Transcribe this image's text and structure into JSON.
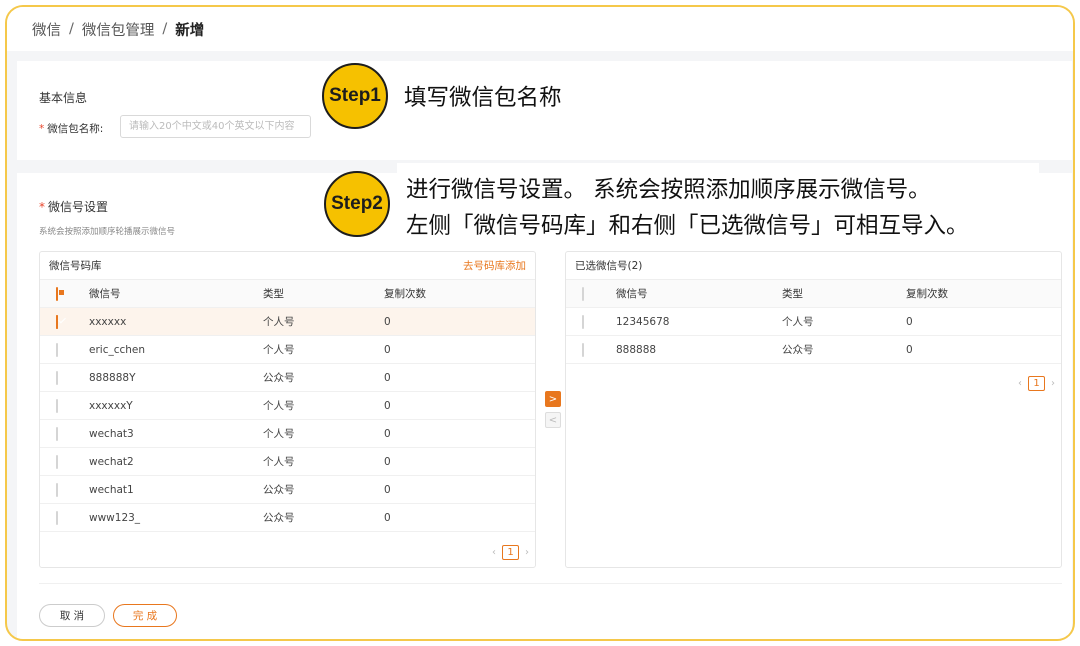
{
  "breadcrumb": {
    "root": "微信",
    "parent": "微信包管理",
    "current": "新增",
    "separator": "/"
  },
  "basic": {
    "title": "基本信息",
    "name_label": "微信包名称:",
    "name_placeholder": "请输入20个中文或40个英文以下内容"
  },
  "wechat_settings": {
    "title": "微信号设置",
    "desc": "系统会按照添加顺序轮播展示微信号"
  },
  "library": {
    "title": "微信号码库",
    "add_link": "去号码库添加",
    "columns": [
      "微信号",
      "类型",
      "复制次数"
    ],
    "rows": [
      {
        "id": "xxxxxx",
        "type": "个人号",
        "count": "0",
        "checked": true
      },
      {
        "id": "eric_cchen",
        "type": "个人号",
        "count": "0",
        "checked": false
      },
      {
        "id": "888888Y",
        "type": "公众号",
        "count": "0",
        "checked": false
      },
      {
        "id": "xxxxxxY",
        "type": "个人号",
        "count": "0",
        "checked": false
      },
      {
        "id": "wechat3",
        "type": "个人号",
        "count": "0",
        "checked": false
      },
      {
        "id": "wechat2",
        "type": "个人号",
        "count": "0",
        "checked": false
      },
      {
        "id": "wechat1",
        "type": "公众号",
        "count": "0",
        "checked": false
      },
      {
        "id": "www123_",
        "type": "公众号",
        "count": "0",
        "checked": false
      }
    ],
    "page": "1"
  },
  "selected": {
    "title": "已选微信号(2)",
    "columns": [
      "微信号",
      "类型",
      "复制次数"
    ],
    "rows": [
      {
        "id": "12345678",
        "type": "个人号",
        "count": "0",
        "checked": false
      },
      {
        "id": "888888",
        "type": "公众号",
        "count": "0",
        "checked": false
      }
    ],
    "page": "1"
  },
  "pager": {
    "prev": "‹",
    "next": "›"
  },
  "transfer": {
    "to_right": ">",
    "to_left": "<"
  },
  "buttons": {
    "cancel": "取 消",
    "done": "完 成"
  },
  "annotations": {
    "step1": "Step1",
    "step1_text": "填写微信包名称",
    "step2": "Step2",
    "step2_line1": "进行微信号设置。 系统会按照添加顺序展示微信号。",
    "step2_line2": "左侧「微信号码库」和右侧「已选微信号」可相互导入。"
  },
  "colors": {
    "accent": "#e8771e",
    "step_badge": "#f6c100",
    "frame": "#f5c84a"
  }
}
